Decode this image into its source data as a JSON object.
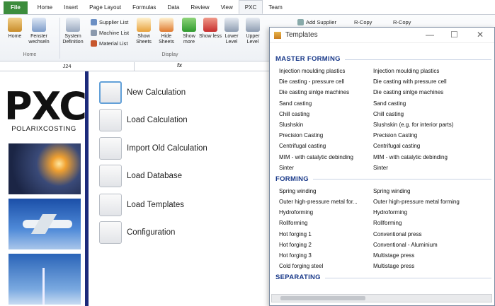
{
  "ribbon": {
    "tabs": [
      "File",
      "Home",
      "Insert",
      "Page Layout",
      "Formulas",
      "Data",
      "Review",
      "View",
      "PXC",
      "Team"
    ],
    "active_tab": "PXC",
    "buttons": [
      {
        "label": "Home",
        "icon": "home-icon"
      },
      {
        "label": "Fenster wechseln",
        "icon": "window-switch-icon"
      },
      {
        "label": "System Definition",
        "icon": "system-definition-icon"
      },
      {
        "label": "Show Sheets",
        "icon": "show-sheets-icon"
      },
      {
        "label": "Hide Sheets",
        "icon": "hide-sheets-icon"
      },
      {
        "label": "Show more",
        "icon": "plus-icon"
      },
      {
        "label": "Show less",
        "icon": "minus-icon"
      },
      {
        "label": "Lower Level",
        "icon": "lower-level-icon"
      },
      {
        "label": "Upper Level",
        "icon": "upper-level-icon"
      }
    ],
    "small": [
      {
        "label": "Supplier List",
        "icon": "supplier-list-icon"
      },
      {
        "label": "Machine List",
        "icon": "machine-list-icon"
      },
      {
        "label": "Material List",
        "icon": "material-list-icon"
      }
    ],
    "groups": {
      "home": "Home",
      "display": "Display"
    },
    "extra": [
      "Add Supplier",
      "R-Copy",
      "R-Copy"
    ]
  },
  "formula_bar": {
    "cell": "J24",
    "fx": "fx"
  },
  "logo": {
    "title": "PXC",
    "subtitle": "POLARIXCOSTING"
  },
  "menu": [
    "New Calculation",
    "Load Calculation",
    "Import Old Calculation",
    "Load Database",
    "Load Templates",
    "Configuration"
  ],
  "dialog": {
    "title": "Templates",
    "controls": [
      "—",
      "☐",
      "✕"
    ],
    "categories": [
      {
        "name": "MASTER FORMING",
        "rows": [
          [
            "Injection moulding plastics",
            "Injection moulding plastics"
          ],
          [
            "Die casting - pressure cell",
            "Die casting with pressure cell"
          ],
          [
            "Die casting sinlge machines",
            "Die casting sinlge machines"
          ],
          [
            "Sand casting",
            "Sand casting"
          ],
          [
            "Chill casting",
            "Chill casting"
          ],
          [
            "Slushskin",
            "Slushskin (e.g. for interior parts)"
          ],
          [
            "Precision Casting",
            "Precision Casting"
          ],
          [
            "Centrifugal casting",
            "Centrifugal casting"
          ],
          [
            "MIM - with catalytic debinding",
            "MIM - with catalytic debinding"
          ],
          [
            "Sinter",
            "Sinter"
          ]
        ]
      },
      {
        "name": "FORMING",
        "rows": [
          [
            "Spring winding",
            "Spring winding"
          ],
          [
            "Outer high-pressure metal for...",
            "Outer high-pressure metal forming"
          ],
          [
            "Hydroforming",
            "Hydroforming"
          ],
          [
            "Rollforming",
            "Rollforming"
          ],
          [
            "Hot forging 1",
            "Conventional press"
          ],
          [
            "Hot forging 2",
            "Conventional - Aluminium"
          ],
          [
            "Hot forging 3",
            "Multistage press"
          ],
          [
            "Cold forging steel",
            "Multistage press"
          ]
        ]
      },
      {
        "name": "SEPARATING",
        "rows": []
      }
    ]
  }
}
